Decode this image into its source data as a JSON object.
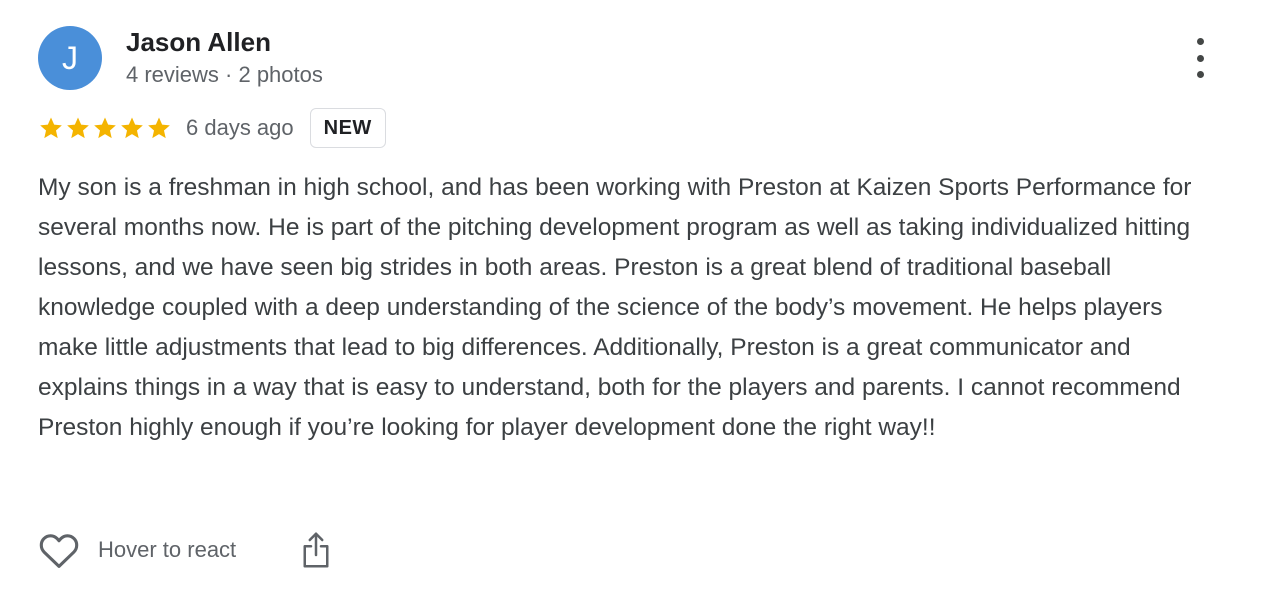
{
  "author": {
    "initial": "J",
    "name": "Jason Allen",
    "meta": "4 reviews · 2 photos",
    "avatar_color": "#4a8fd9"
  },
  "menu": {
    "icon": "more-vert-icon"
  },
  "rating": {
    "stars": 5,
    "max_stars": 5,
    "star_color": "#f4b400",
    "date": "6 days ago",
    "badge": "NEW"
  },
  "review": {
    "text": "My son is a freshman in high school, and has been working with Preston at Kaizen Sports Performance for several months now. He is part of the pitching development program as well as taking individualized hitting lessons, and we have seen big strides in both areas. Preston is a great blend of traditional baseball knowledge coupled with a deep understanding of the science of the body’s movement. He helps players make little adjustments that lead to big differences. Additionally, Preston is a great communicator and explains things in a way that is easy to understand, both for the players and parents. I cannot recommend Preston highly enough if you’re looking for player development done the right way!!"
  },
  "actions": {
    "react_icon": "heart-icon",
    "react_label": "Hover to react",
    "share_icon": "share-icon"
  }
}
